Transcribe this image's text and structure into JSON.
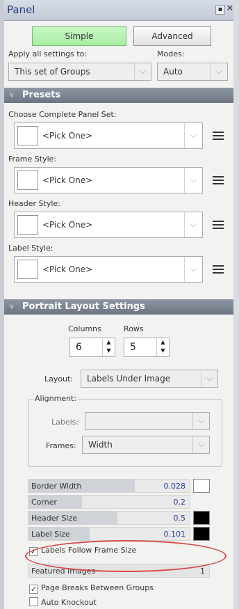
{
  "window": {
    "title": "Panel",
    "pin_glyph": "▪",
    "close_glyph": "✕"
  },
  "mode_buttons": {
    "simple": "Simple",
    "advanced": "Advanced"
  },
  "apply": {
    "label": "Apply all settings to:",
    "value": "This set of Groups",
    "modes_label": "Modes:",
    "modes_value": "Auto"
  },
  "presets": {
    "header": "Presets",
    "fields": [
      {
        "label": "Choose Complete Panel Set:",
        "value": "<Pick One>"
      },
      {
        "label": "Frame Style:",
        "value": "<Pick One>"
      },
      {
        "label": "Header Style:",
        "value": "<Pick One>"
      },
      {
        "label": "Label Style:",
        "value": "<Pick One>"
      }
    ]
  },
  "portrait": {
    "header": "Portrait Layout Settings",
    "columns_label": "Columns",
    "rows_label": "Rows",
    "columns_value": "6",
    "rows_value": "5",
    "layout_label": "Layout:",
    "layout_value": "Labels Under Image",
    "alignment_label": "Alignment:",
    "labels_label": "Labels:",
    "labels_value": "",
    "frames_label": "Frames:",
    "frames_value": "Width"
  },
  "sliders": [
    {
      "name": "Border Width",
      "value": "0.028",
      "fill": 0.66,
      "color": "#ffffff"
    },
    {
      "name": "Corner",
      "value": "0.2",
      "fill": 0.33,
      "color": null
    },
    {
      "name": "Header Size",
      "value": "0.5",
      "fill": 0.55,
      "color": "#000000"
    },
    {
      "name": "Label Size",
      "value": "0.101",
      "fill": 0.38,
      "color": "#000000"
    }
  ],
  "checks": {
    "labels_follow": {
      "label": "Labels Follow Frame Size",
      "checked": true
    },
    "page_breaks": {
      "label": "Page Breaks Between Groups",
      "checked": true
    },
    "auto_knockout": {
      "label": "Auto Knockout",
      "checked": false
    }
  },
  "featured": {
    "name": "Featured Images",
    "value": "1"
  },
  "colors": {
    "accent_green": "#a9eea3",
    "section_bar": "#6d7583",
    "highlight": "#d64a4a"
  }
}
